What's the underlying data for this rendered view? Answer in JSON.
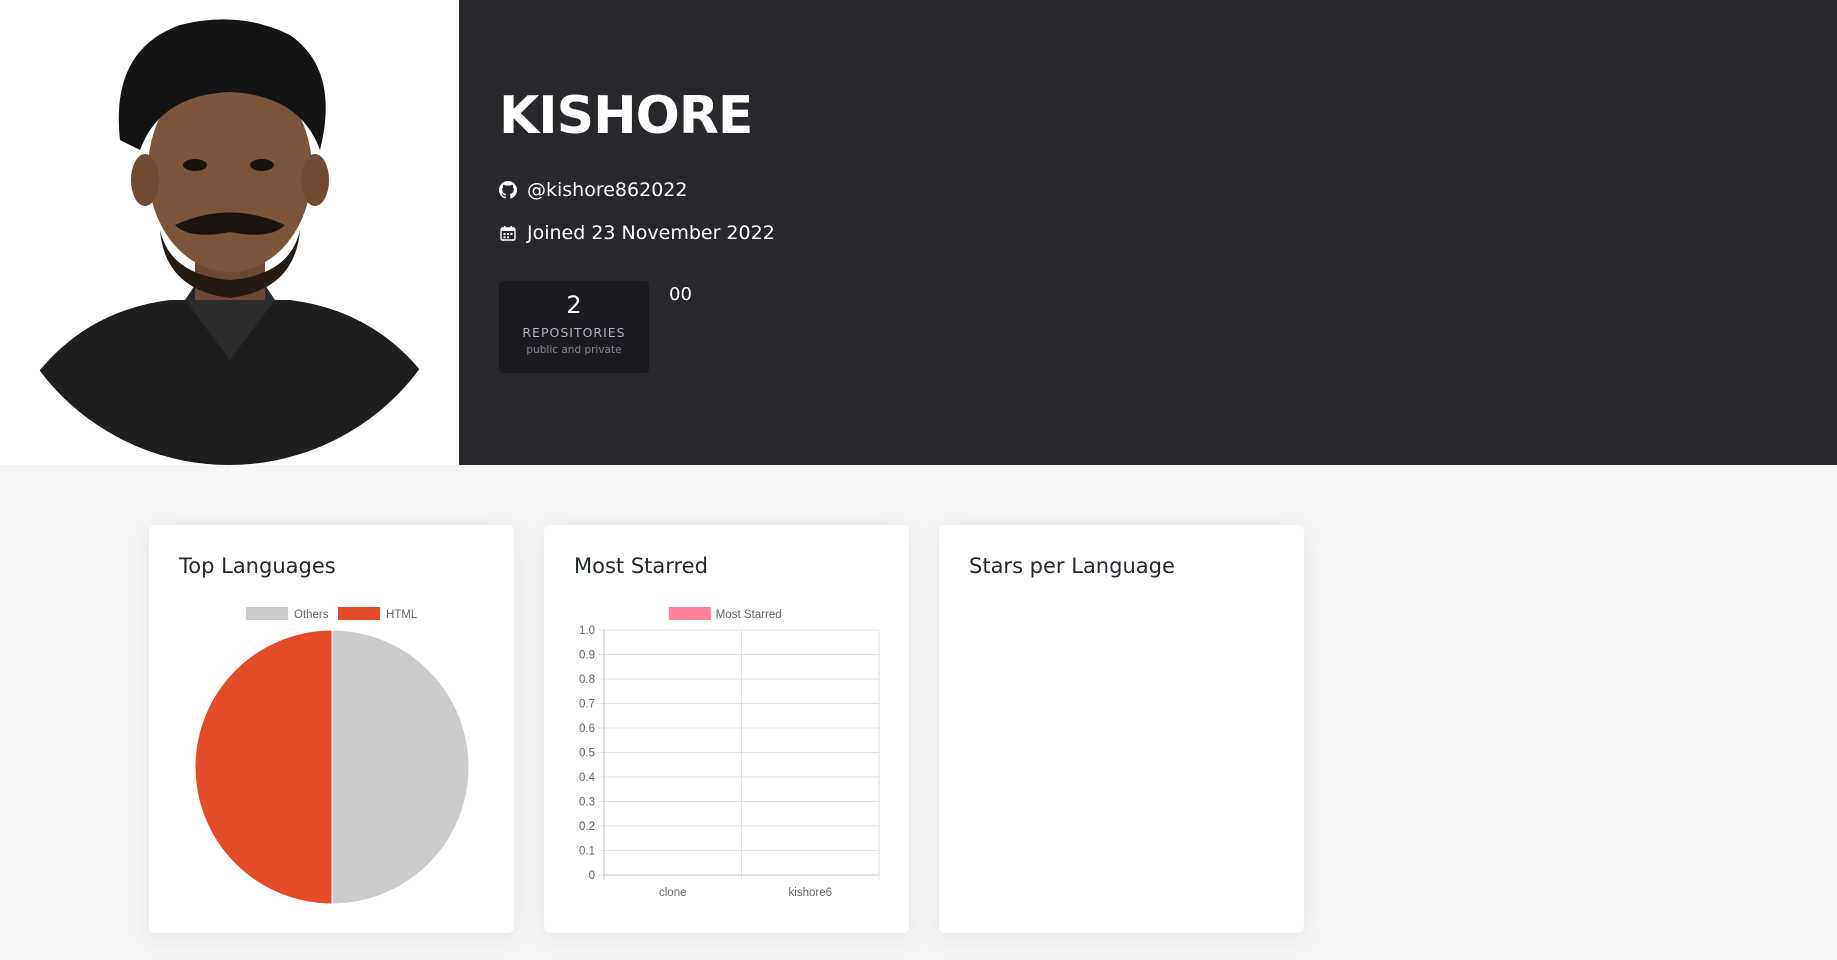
{
  "profile": {
    "name": "KISHORE",
    "username": "@kishore862022",
    "joined": "Joined 23 November 2022",
    "icons": {
      "user": "github-icon",
      "joined": "calendar-icon"
    }
  },
  "stats": {
    "repositories": {
      "value": "2",
      "label": "REPOSITORIES",
      "sublabel": "public and private"
    },
    "extra_value": "00"
  },
  "cards": {
    "top_languages": {
      "title": "Top Languages"
    },
    "most_starred": {
      "title": "Most Starred"
    },
    "stars_per_language": {
      "title": "Stars per Language"
    }
  },
  "colors": {
    "header_bg": "#27272c",
    "stat_bg": "#1c1c20",
    "html": "#e34c26",
    "others": "#cccccc",
    "most_starred": "#ff829d"
  },
  "chart_data": [
    {
      "type": "pie",
      "title": "",
      "legend": [
        "Others",
        "HTML"
      ],
      "values": [
        1,
        1
      ],
      "colors": [
        "#cccccc",
        "#e34c26"
      ],
      "legend_position": "top"
    },
    {
      "type": "bar",
      "title": "",
      "categories": [
        "clone",
        "kishore6"
      ],
      "series": [
        {
          "name": "Most Starred",
          "values": [
            0,
            0
          ],
          "color": "#ff829d"
        }
      ],
      "ylim": [
        0,
        1
      ],
      "yticks": [
        "1.0",
        "0.9",
        "0.8",
        "0.7",
        "0.6",
        "0.5",
        "0.4",
        "0.3",
        "0.2",
        "0.1",
        "0"
      ],
      "grid": true,
      "legend_position": "top"
    }
  ]
}
